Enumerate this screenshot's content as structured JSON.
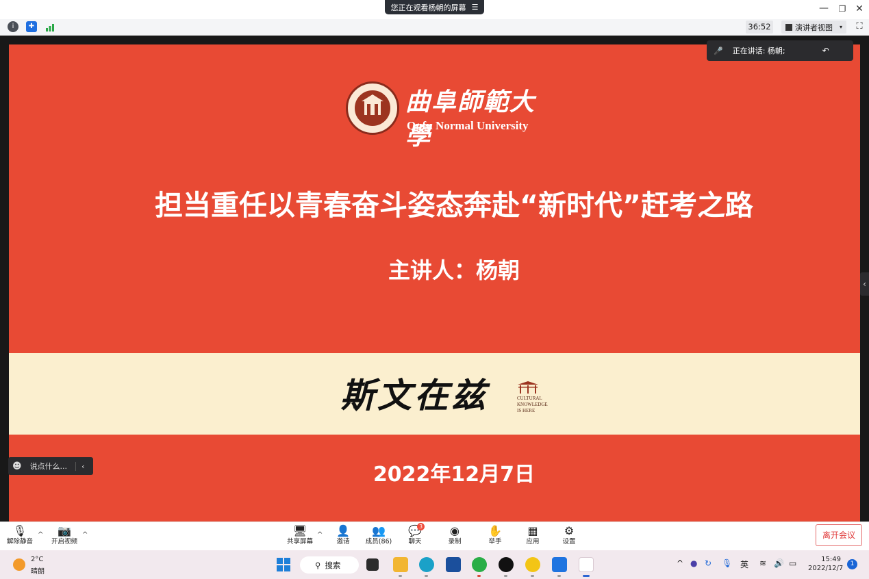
{
  "window": {
    "share_banner": "您正在观看杨朝的屏幕",
    "minimize_glyph": "—",
    "restore_glyph": "❐",
    "close_glyph": "✕"
  },
  "toolbar": {
    "timer": "36:52",
    "view_mode": "演讲者视图",
    "icons": [
      "info-icon",
      "shield-icon",
      "signal-icon",
      "fullscreen-icon"
    ]
  },
  "slide": {
    "university_cn": "曲阜師範大學",
    "university_en": "Qufu Normal University",
    "title": "担当重任以青春奋斗姿态奔赴“新时代”赶考之路",
    "speaker": "主讲人：杨朝",
    "band_brush_text": "斯文在兹",
    "band_tag_lines": [
      "CULTURAL",
      "KNOWLEDGE",
      "IS HERE"
    ],
    "date": "2022年12月7日",
    "colors": {
      "red": "#e84a34",
      "band": "#fbefcf"
    }
  },
  "speaking": {
    "label": "正在讲话: 杨朝;"
  },
  "chat": {
    "placeholder": "说点什么..."
  },
  "controls": {
    "unmute": "解除静音",
    "video": "开启视频",
    "share": "共享屏幕",
    "invite": "邀请",
    "members": "成员(86)",
    "chat": "聊天",
    "chat_badge": "3",
    "record": "录制",
    "raise_hand": "举手",
    "apps": "应用",
    "settings": "设置",
    "leave": "离开会议"
  },
  "taskbar": {
    "weather_temp": "2°C",
    "weather_desc": "晴朗",
    "search": "搜索",
    "ime": "英",
    "time": "15:49",
    "date": "2022/12/7",
    "notifications": "1"
  }
}
